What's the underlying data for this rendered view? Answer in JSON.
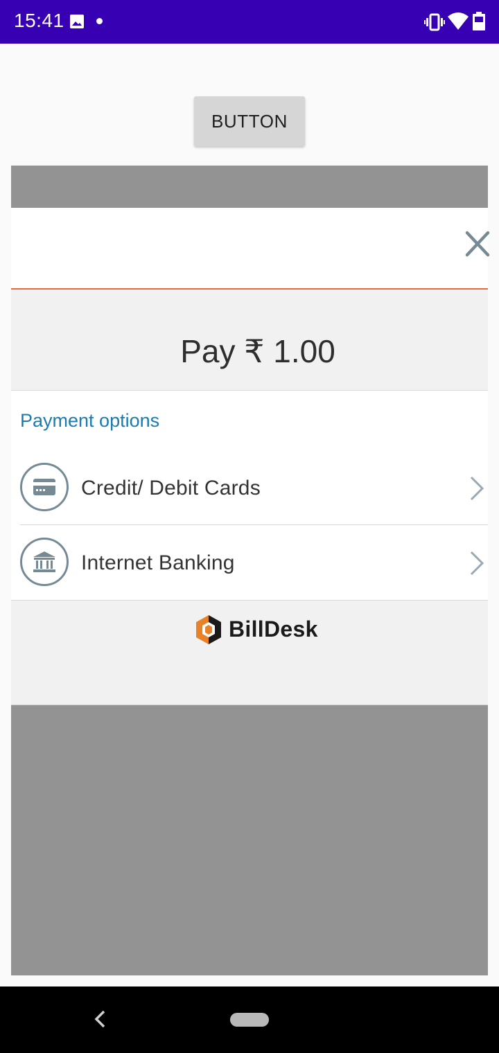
{
  "status_bar": {
    "time": "15:41",
    "icons": [
      "photo-icon",
      "dot-icon",
      "vibrate-icon",
      "wifi-icon",
      "battery-icon"
    ]
  },
  "app": {
    "button_label": "BUTTON"
  },
  "modal": {
    "close_icon": "close-icon",
    "pay_text": "Pay ₹ 1.00",
    "options_title": "Payment options",
    "options": [
      {
        "label": "Credit/ Debit Cards",
        "icon": "card-icon"
      },
      {
        "label": "Internet Banking",
        "icon": "bank-icon"
      }
    ],
    "brand": "BillDesk"
  },
  "nav_bar": {
    "icons": [
      "back-icon",
      "home-pill"
    ]
  },
  "colors": {
    "status_bar": "#3700b3",
    "accent_orange": "#e8683a",
    "link_blue": "#1a7bb0",
    "icon_grey": "#758a94"
  }
}
